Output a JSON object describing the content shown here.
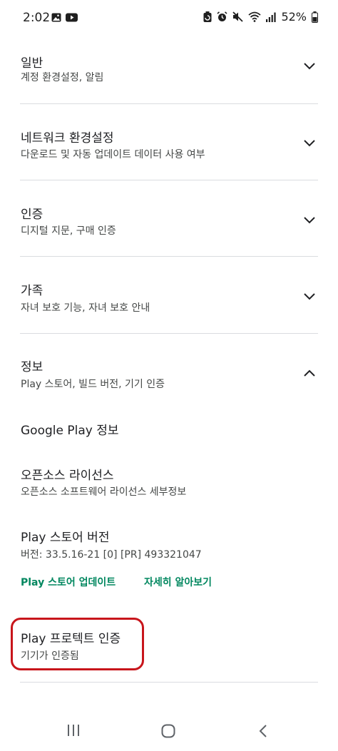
{
  "status_bar": {
    "time": "2:02",
    "battery": "52%",
    "left_icons": [
      "gallery-icon",
      "youtube-icon"
    ],
    "right_icons": [
      "battery-saver-icon",
      "alarm-icon",
      "mute-icon",
      "wifi-icon",
      "signal-icon",
      "battery-icon"
    ]
  },
  "sections": [
    {
      "title": "일반",
      "subtitle": "계정 환경설정, 알림",
      "expanded": false
    },
    {
      "title": "네트워크 환경설정",
      "subtitle": "다운로드 및 자동 업데이트 데이터 사용 여부",
      "expanded": false
    },
    {
      "title": "인증",
      "subtitle": "디지털 지문, 구매 인증",
      "expanded": false
    },
    {
      "title": "가족",
      "subtitle": "자녀 보호 기능, 자녀 보호 안내",
      "expanded": false
    },
    {
      "title": "정보",
      "subtitle": "Play 스토어, 빌드 버전, 기기 인증",
      "expanded": true
    }
  ],
  "about": {
    "google_play_info": "Google Play 정보",
    "open_source_title": "오픈소스 라이선스",
    "open_source_sub": "오픈소스 소프트웨어 라이선스 세부정보",
    "version_title": "Play 스토어 버전",
    "version_sub": "버전: 33.5.16-21 [0] [PR] 493321047",
    "update_link": "Play 스토어 업데이트",
    "learn_more_link": "자세히 알아보기",
    "protect_title": "Play 프로텍트 인증",
    "protect_sub": "기기가 인증됨"
  },
  "colors": {
    "accent_green": "#01875f",
    "highlight_red": "#c8151b",
    "divider": "#dadce0"
  },
  "nav_bar": {
    "icons": [
      "recent-apps-icon",
      "home-icon",
      "back-icon"
    ]
  }
}
